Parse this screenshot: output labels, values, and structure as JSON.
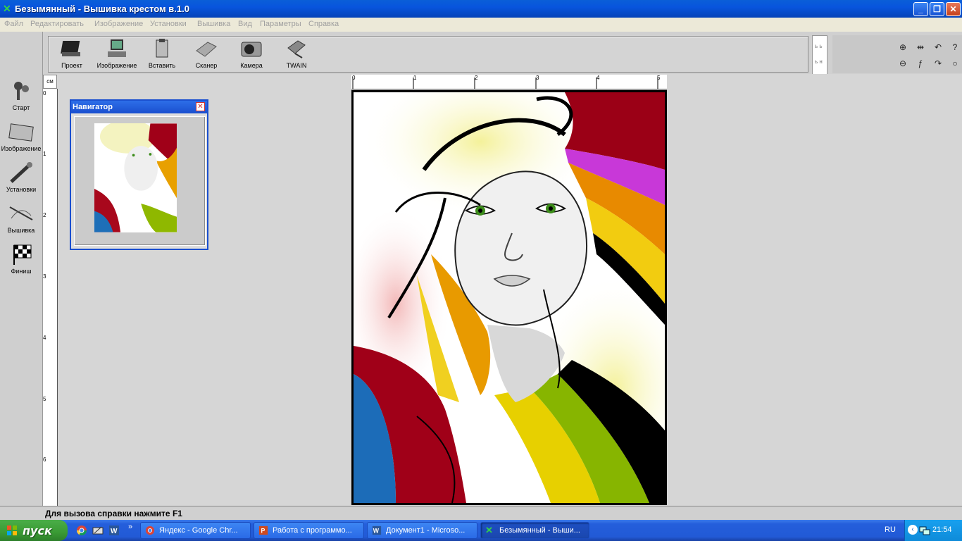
{
  "window": {
    "title": "Безымянный - Вышивка крестом в.1.0",
    "minimize": "_",
    "restore": "❐",
    "close": "✕"
  },
  "menu": [
    "Файл",
    "Редактировать",
    "Изображение",
    "Установки",
    "Вышивка",
    "Вид",
    "Параметры",
    "Справка"
  ],
  "toolbar": {
    "project": "Проект",
    "image": "Изображение",
    "paste": "Вставить",
    "scanner": "Сканер",
    "camera": "Камера",
    "twain": "TWAIN"
  },
  "side_toolbar": {
    "start": "Старт",
    "image": "Изображение",
    "settings": "Установки",
    "embroidery": "Вышивка",
    "finish": "Финиш"
  },
  "view_strip": [
    "ь ь",
    "ь н"
  ],
  "ruler": {
    "unit": "см",
    "h_ticks": [
      "0",
      "1",
      "2",
      "3",
      "4",
      "5"
    ],
    "v_ticks": [
      "0",
      "1",
      "2",
      "3",
      "4",
      "5",
      "6"
    ]
  },
  "navigator": {
    "title": "Навигатор",
    "close": "✕"
  },
  "status": "Для вызова справки нажмите F1",
  "taskbar": {
    "start": "пуск",
    "tasks": [
      {
        "label": "Яндекс - Google Chr..."
      },
      {
        "label": "Работа с программо..."
      },
      {
        "label": "Документ1 - Microso..."
      },
      {
        "label": "Безымянный - Выши..."
      }
    ],
    "chevron": "»",
    "lang": "RU",
    "clock": "21:54"
  },
  "colors": {
    "titlebar": "#0855dd",
    "canvas_bg": "#d6d6d6",
    "taskbar": "#245edb",
    "start": "#3a9a34"
  }
}
